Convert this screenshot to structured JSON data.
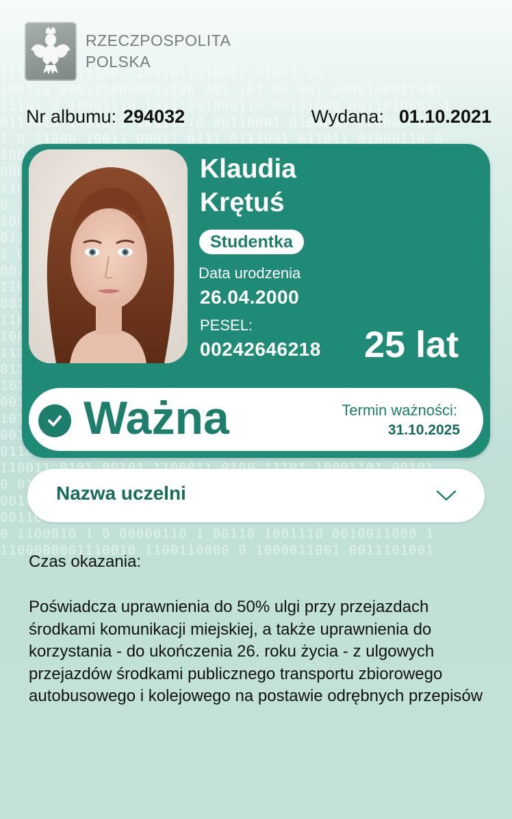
{
  "header": {
    "country_line1": "RZECZPOSPOLITA",
    "country_line2": "POLSKA"
  },
  "info": {
    "album_label": "Nr albumu:",
    "album_number": "294032",
    "issued_label": "Wydana:",
    "issued_date": "01.10.2021"
  },
  "card": {
    "first_name": "Klaudia",
    "last_name": "Krętuś",
    "role": "Studentka",
    "birth_label": "Data urodzenia",
    "birth_date": "26.04.2000",
    "pesel_label": "PESEL:",
    "pesel": "00242646218",
    "age": "25 lat"
  },
  "status": {
    "text": "Ważna",
    "valid_until_label": "Termin ważności:",
    "valid_until": "31.10.2025"
  },
  "university": {
    "label": "Nazwa uczelni"
  },
  "shown_time_label": "Czas okazania:",
  "description": "Poświadcza uprawnienia do 50% ulgi przy przejazdach środkami komunikacji miejskiej, a także uprawnienia do korzystania - do ukończenia 26. roku życia - z ulgowych przejazdów środkami publicznego transportu zbiorowego autobusowego i kolejowego na postawie odrębnych przepisów",
  "colors": {
    "brand_green": "#1f8a76",
    "dark_green": "#166b5c",
    "background": "#c3e2da"
  },
  "icons": {
    "emblem": "polish-eagle-emblem",
    "status": "check-circle-icon",
    "dropdown": "chevron-down-icon"
  }
}
